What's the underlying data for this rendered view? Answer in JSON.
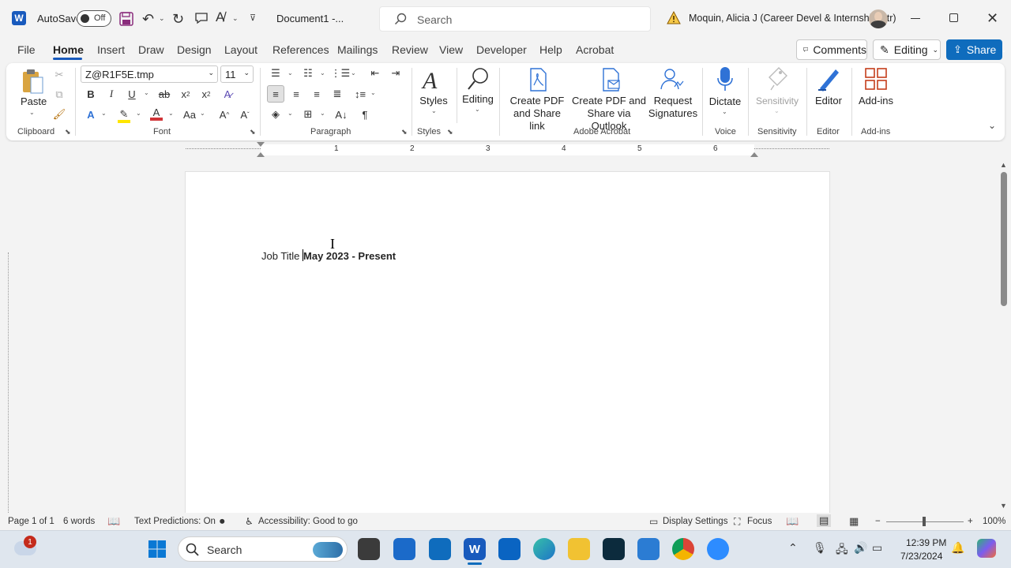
{
  "titlebar": {
    "autosave_label": "AutoSave",
    "autosave_state": "Off",
    "document_name": "Document1  -...",
    "search_placeholder": "Search",
    "user_name": "Moquin, Alicia J (Career Devel & Internship Ctr)"
  },
  "menu": {
    "tabs": [
      "File",
      "Home",
      "Insert",
      "Draw",
      "Design",
      "Layout",
      "References",
      "Mailings",
      "Review",
      "View",
      "Developer",
      "Help",
      "Acrobat"
    ],
    "active": "Home",
    "comments_label": "Comments",
    "editing_label": "Editing",
    "share_label": "Share"
  },
  "ribbon": {
    "paste_label": "Paste",
    "font_name": "Z@R1F5E.tmp",
    "font_size": "11",
    "styles_label": "Styles",
    "editing_label": "Editing",
    "create_pdf_link": [
      "Create PDF",
      "and Share link"
    ],
    "create_pdf_outlook": [
      "Create PDF and",
      "Share via Outlook"
    ],
    "request_signatures": [
      "Request",
      "Signatures"
    ],
    "dictate_label": "Dictate",
    "sensitivity_label": "Sensitivity",
    "editor_label": "Editor",
    "addins_label": "Add-ins",
    "groups": {
      "clipboard": "Clipboard",
      "font": "Font",
      "paragraph": "Paragraph",
      "styles": "Styles",
      "adobe": "Adobe Acrobat",
      "voice": "Voice",
      "sensitivity": "Sensitivity",
      "editor": "Editor",
      "addins": "Add-ins"
    }
  },
  "ruler": {
    "numbers": [
      "1",
      "2",
      "3",
      "4",
      "5",
      "6"
    ]
  },
  "document": {
    "plain_text": "Job Title ",
    "bold_text": "May 2023 - Present"
  },
  "statusbar": {
    "page": "Page 1 of 1",
    "words": "6 words",
    "text_predictions": "Text Predictions: On",
    "accessibility": "Accessibility: Good to go",
    "display_settings": "Display Settings",
    "focus": "Focus",
    "zoom": "100%"
  },
  "taskbar": {
    "search_label": "Search",
    "notification_count": "1",
    "time": "12:39 PM",
    "date": "7/23/2024"
  },
  "colors": {
    "accent": "#185abd",
    "share_bg": "#0f6cbd",
    "word_blue": "#185abd"
  }
}
